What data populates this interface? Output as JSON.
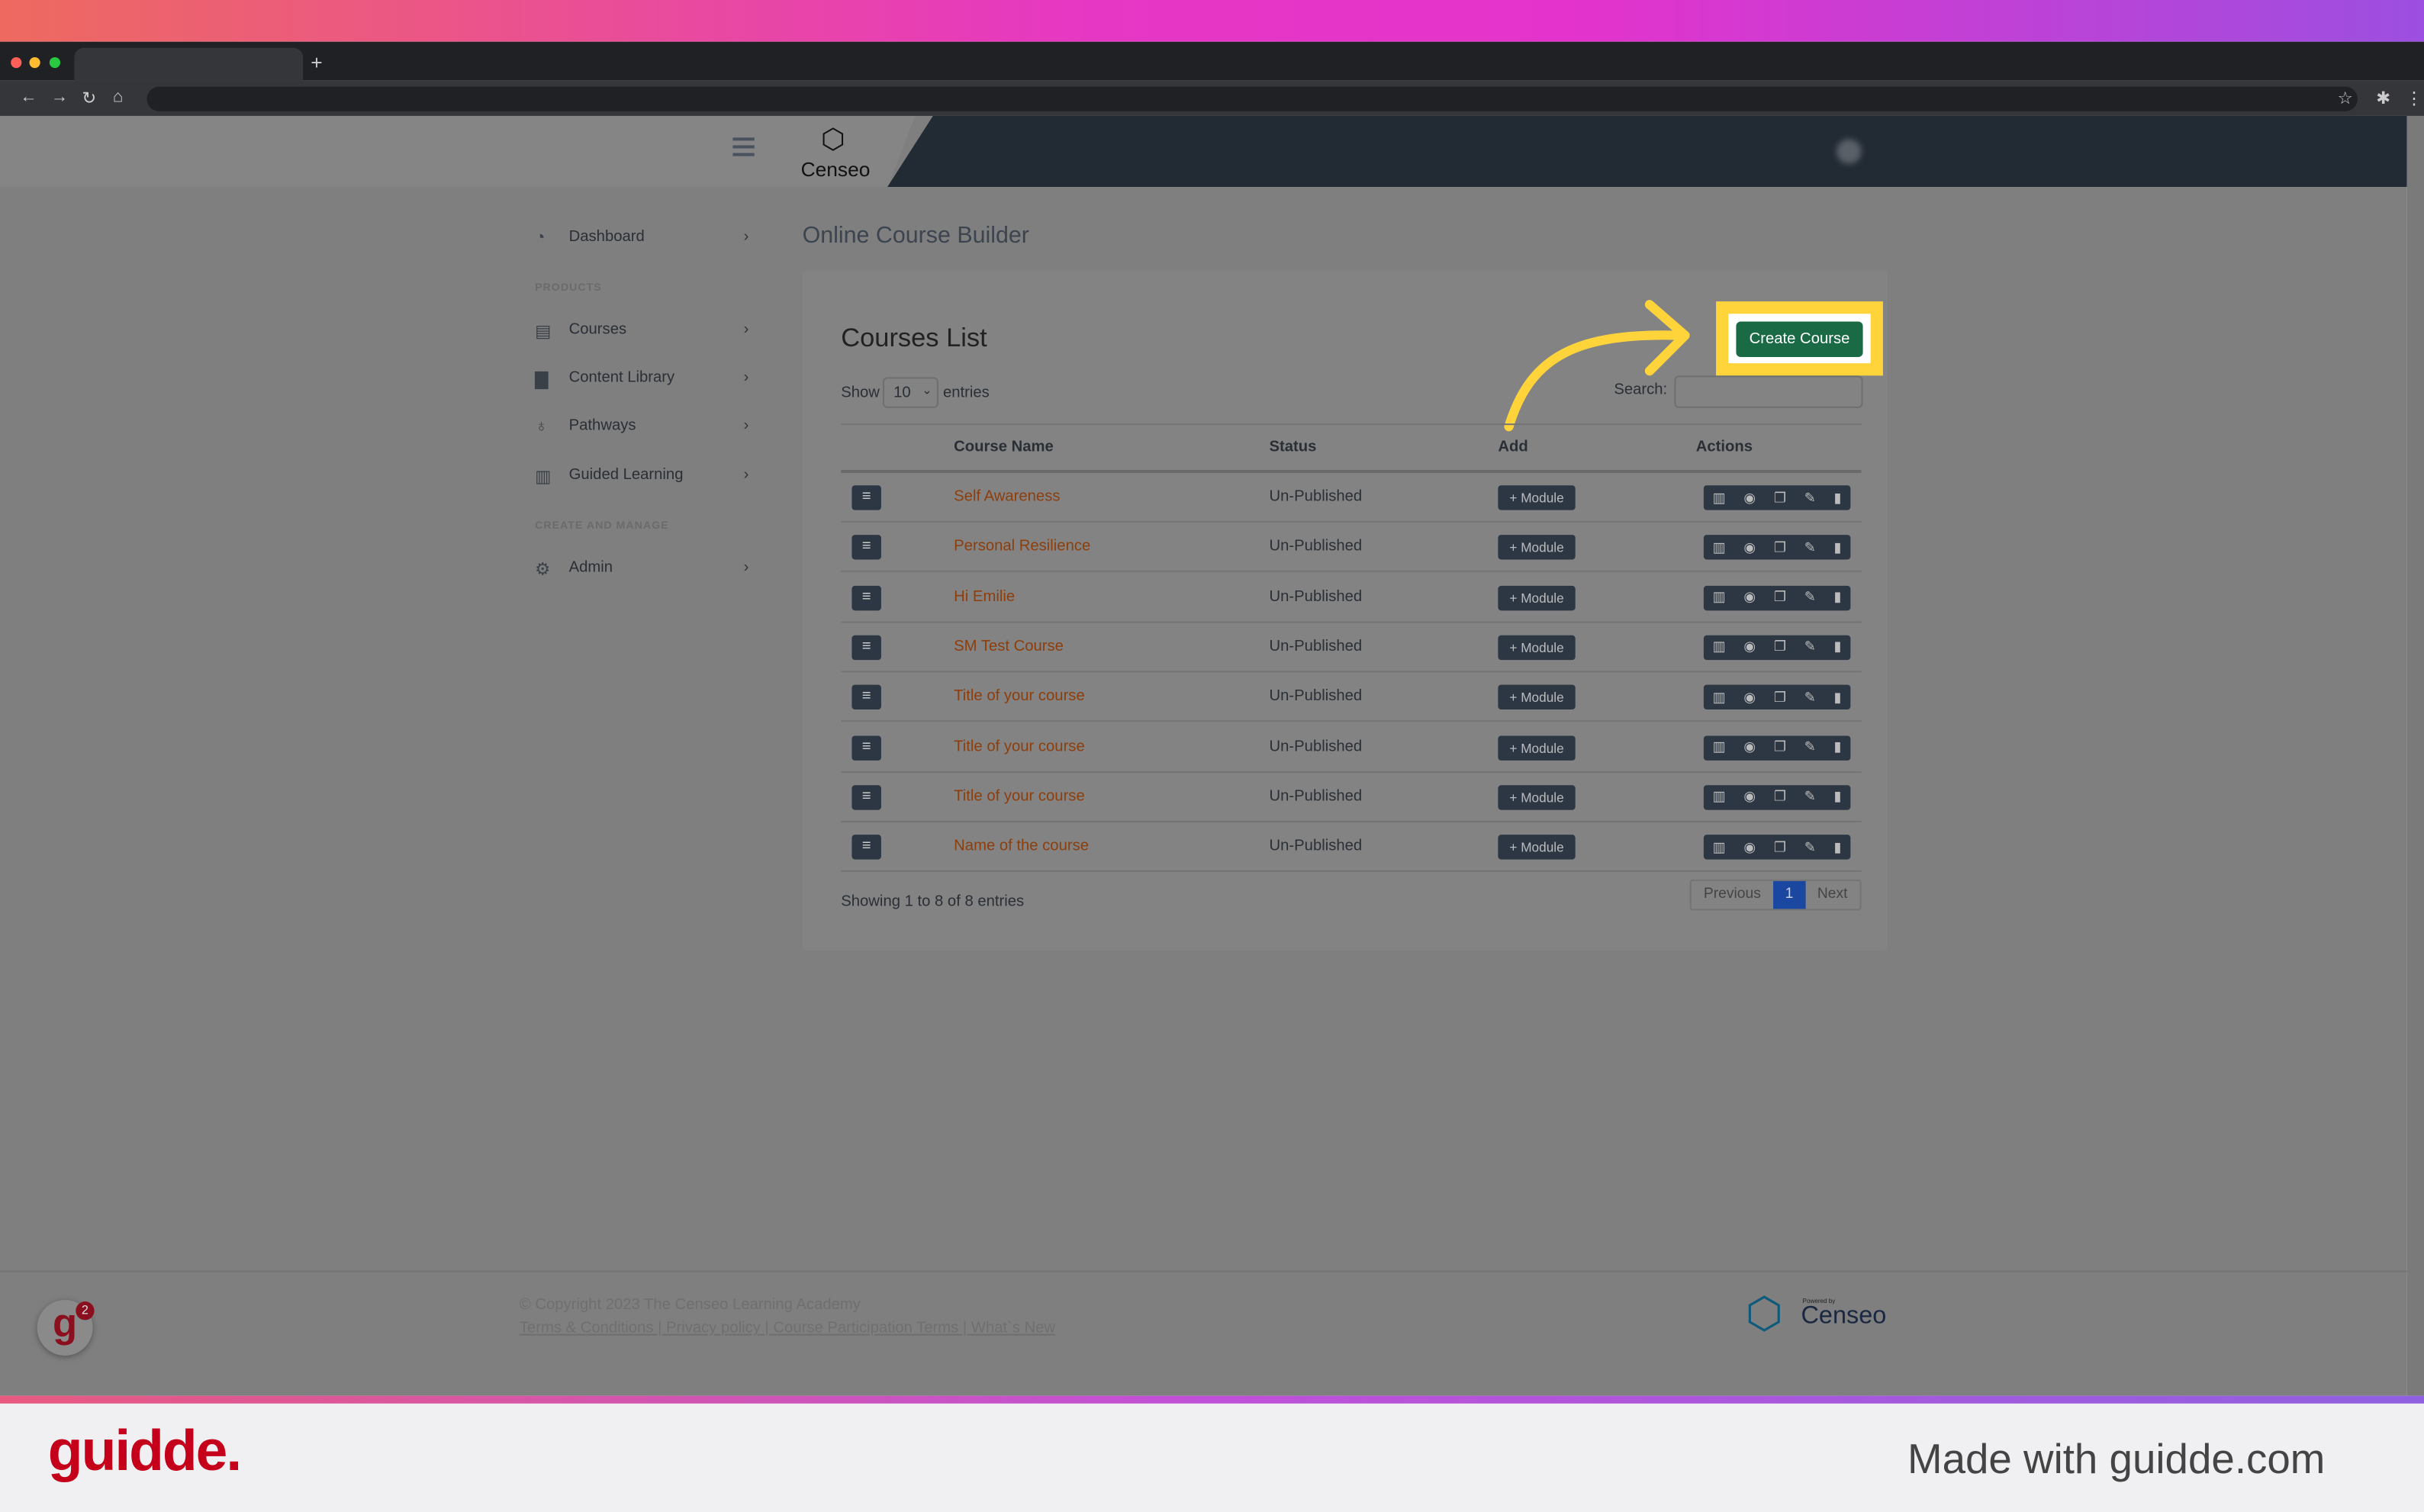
{
  "header": {
    "brand": "Censeo"
  },
  "sidebar": {
    "items": [
      {
        "label": "Dashboard",
        "icon": "dashboard-icon"
      }
    ],
    "section1": "PRODUCTS",
    "products": [
      {
        "label": "Courses",
        "icon": "courses-icon"
      },
      {
        "label": "Content Library",
        "icon": "book-icon"
      },
      {
        "label": "Pathways",
        "icon": "award-icon"
      },
      {
        "label": "Guided Learning",
        "icon": "clipboard-icon"
      }
    ],
    "section2": "CREATE AND MANAGE",
    "manage": [
      {
        "label": "Admin",
        "icon": "gear-icon"
      }
    ]
  },
  "main": {
    "page_title": "Online Course Builder",
    "card_title": "Courses List",
    "create_label": "Create Course",
    "show_label": "Show",
    "entries_value": "10",
    "entries_label": "entries",
    "search_label": "Search:",
    "search_value": "",
    "columns": [
      "Course Name",
      "Status",
      "Add",
      "Actions"
    ],
    "rows": [
      {
        "name": "Self Awareness",
        "status": "Un-Published",
        "add": "+ Module"
      },
      {
        "name": "Personal Resilience",
        "status": "Un-Published",
        "add": "+ Module"
      },
      {
        "name": "Hi Emilie",
        "status": "Un-Published",
        "add": "+ Module"
      },
      {
        "name": "SM Test Course",
        "status": "Un-Published",
        "add": "+ Module"
      },
      {
        "name": "Title of your course",
        "status": "Un-Published",
        "add": "+ Module"
      },
      {
        "name": "Title of your course",
        "status": "Un-Published",
        "add": "+ Module"
      },
      {
        "name": "Title of your course",
        "status": "Un-Published",
        "add": "+ Module"
      },
      {
        "name": "Name of the course",
        "status": "Un-Published",
        "add": "+ Module"
      }
    ],
    "showing": "Showing 1 to 8 of 8 entries",
    "pagination": {
      "previous": "Previous",
      "current": "1",
      "next": "Next"
    }
  },
  "footer": {
    "copyright": "© Copyright 2023 The Censeo Learning Academy",
    "links": [
      "Terms & Conditions",
      "Privacy policy",
      "Course Participation Terms",
      "What`s New"
    ],
    "powered": "Powered by",
    "brand": "Censeo"
  },
  "guidde": {
    "badge_count": "2",
    "logo": "guidde.",
    "made_with": "Made with guidde.com"
  },
  "colors": {
    "accent_green": "#1a6b45",
    "highlight": "#ffd43b",
    "link": "#8d3e0b",
    "guidde_red": "#c4001a"
  }
}
